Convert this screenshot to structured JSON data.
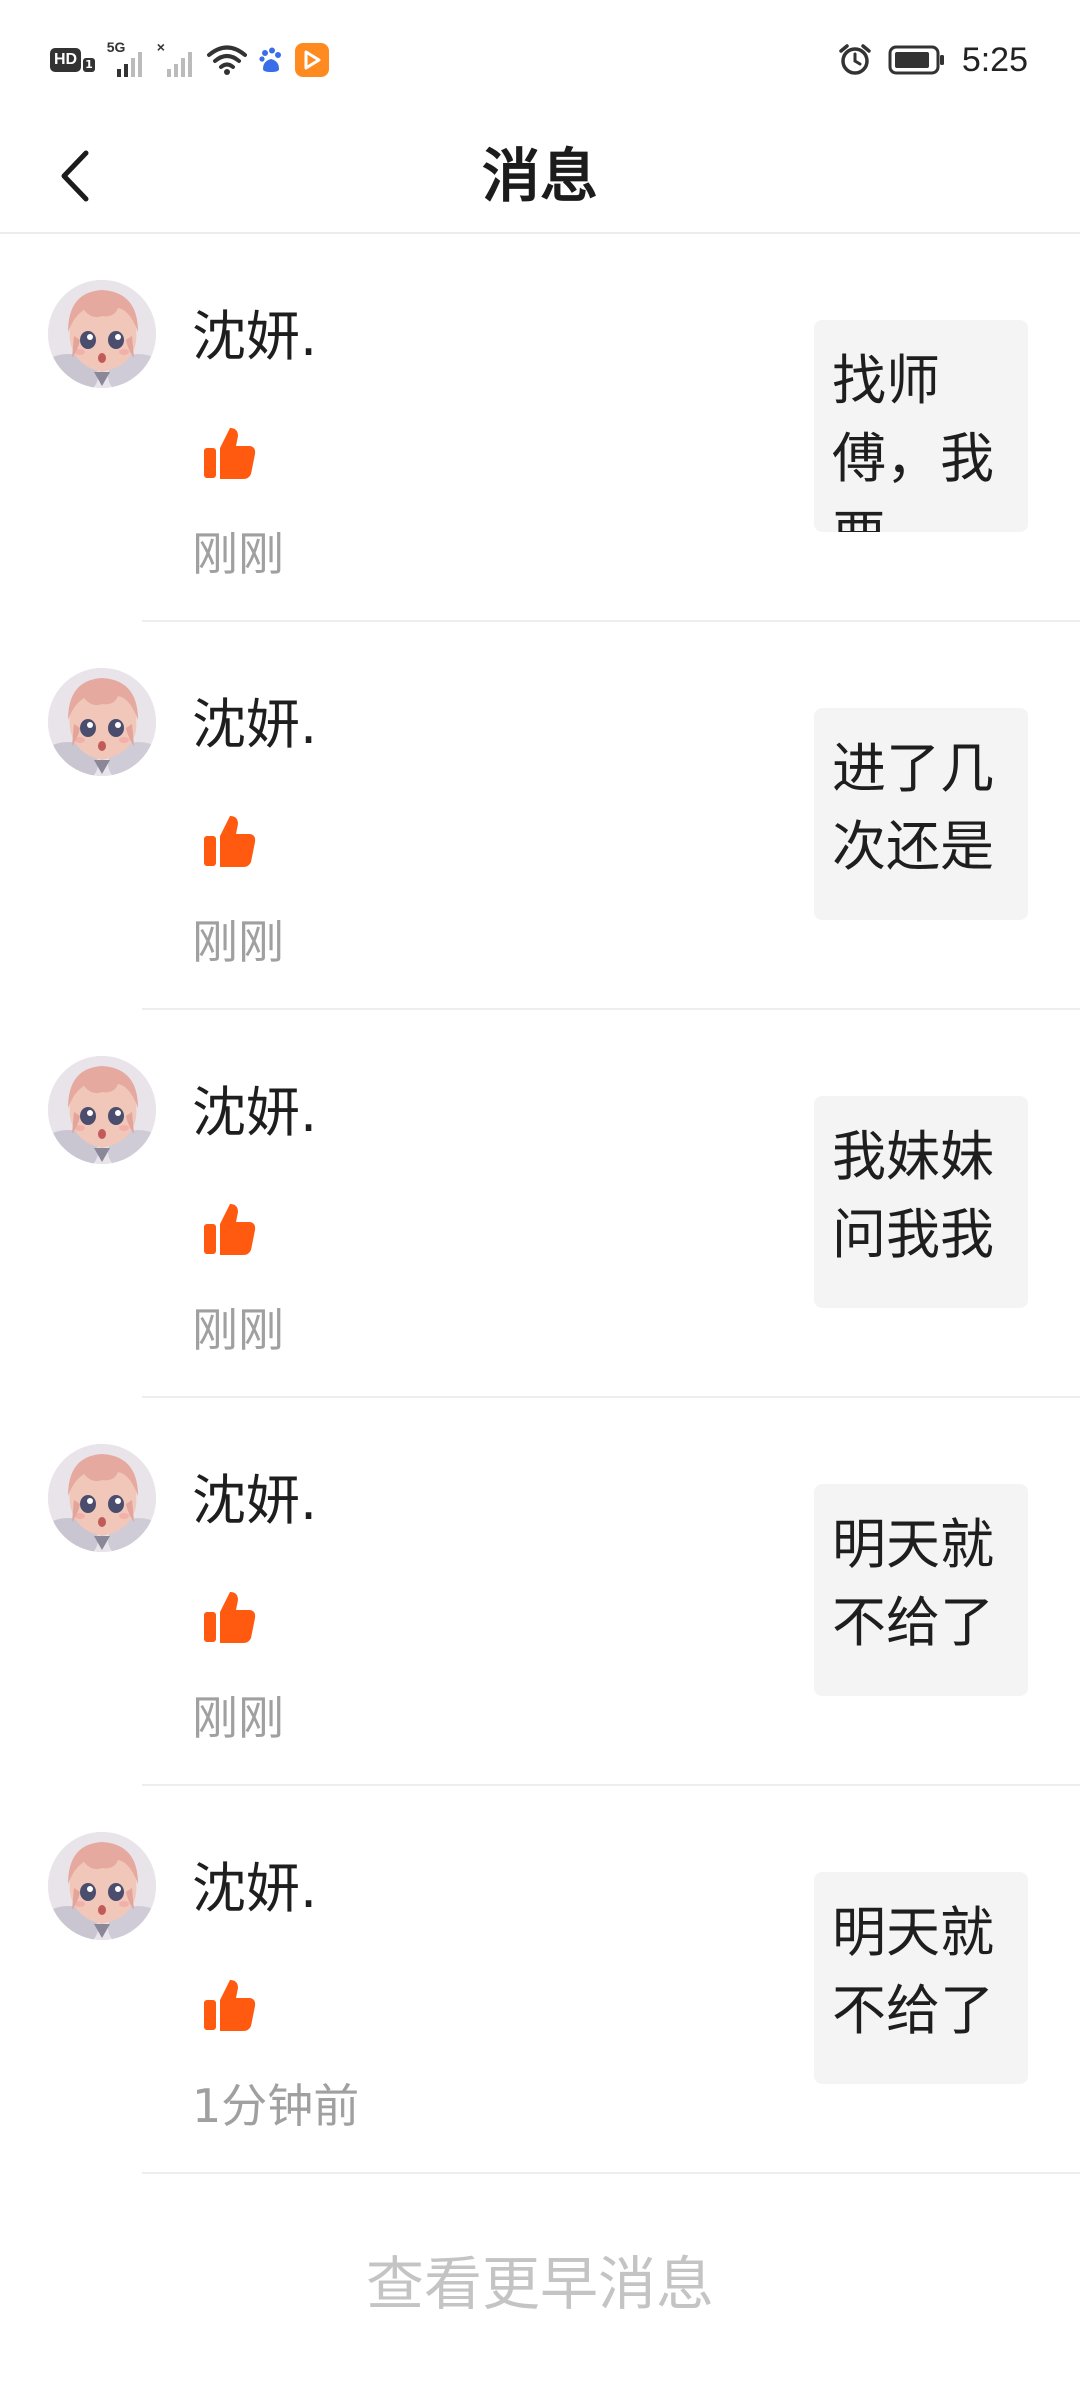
{
  "status_bar": {
    "hd_label": "HD",
    "hd_sub": "1",
    "sim1_tag": "5G",
    "sim2_tag": "×",
    "time": "5:25"
  },
  "header": {
    "title": "消息"
  },
  "messages": [
    {
      "name": "沈妍.",
      "time": "刚刚",
      "quote": "找师傅，我要"
    },
    {
      "name": "沈妍.",
      "time": "刚刚",
      "quote": "进了几次还是"
    },
    {
      "name": "沈妍.",
      "time": "刚刚",
      "quote": "我妹妹问我我"
    },
    {
      "name": "沈妍.",
      "time": "刚刚",
      "quote": "明天就不给了"
    },
    {
      "name": "沈妍.",
      "time": "1分钟前",
      "quote": "明天就不给了"
    }
  ],
  "footer": {
    "more_label": "查看更早消息"
  },
  "colors": {
    "like": "#ff5a10",
    "accent_play": "#ff8a1f",
    "muted_text": "#a0a0a0"
  },
  "icons": {
    "back": "chevron-left-icon",
    "like": "thumbs-up-icon",
    "alarm": "alarm-icon",
    "battery": "battery-icon",
    "wifi": "wifi-icon"
  }
}
